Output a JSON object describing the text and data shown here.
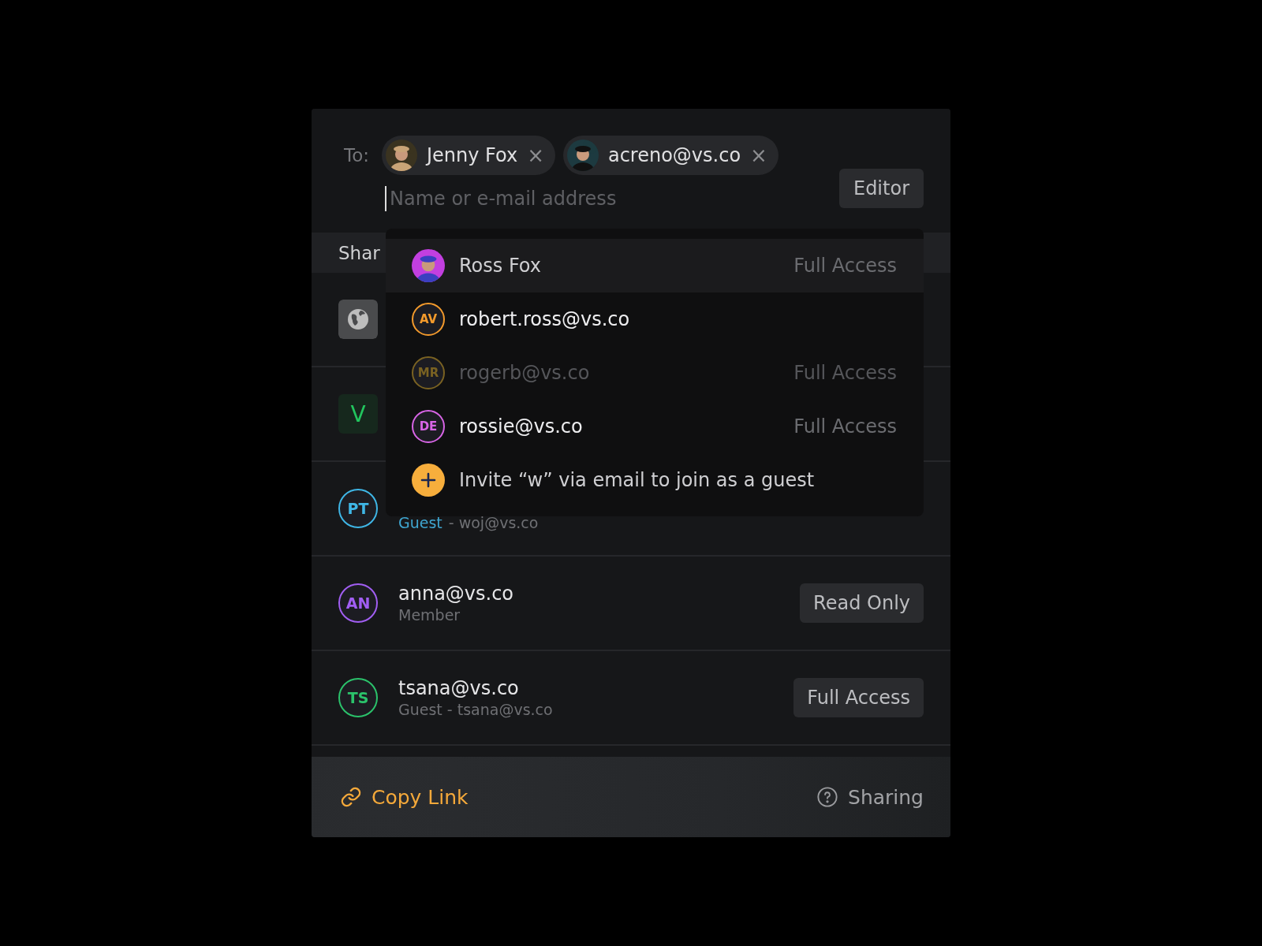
{
  "recipients": {
    "label": "To:",
    "chips": [
      {
        "name": "Jenny Fox",
        "remove": "×"
      },
      {
        "name": "acreno@vs.co",
        "remove": "×"
      }
    ],
    "input": {
      "placeholder": "Name or e-mail address"
    },
    "role_button": "Editor"
  },
  "section_header": "Shar",
  "rows": [
    {
      "kind": "globe"
    },
    {
      "kind": "letter",
      "initials": "V",
      "color": "#22c55e"
    },
    {
      "kind": "person",
      "initials": "PT",
      "color": "#3fb6e6",
      "subtitle_link": "Guest",
      "subtitle": "- woj@vs.co"
    },
    {
      "kind": "person",
      "initials": "AN",
      "color": "#a15ef2",
      "name": "anna@vs.co",
      "subtitle": "Member",
      "access": "Read Only"
    },
    {
      "kind": "person",
      "initials": "TS",
      "color": "#2bc26b",
      "name": "tsana@vs.co",
      "subtitle": "Guest - tsana@vs.co",
      "access": "Full Access"
    }
  ],
  "suggestions": [
    {
      "name": "Ross Fox",
      "access": "Full Access",
      "selected": true,
      "disabled": false
    },
    {
      "kind": "initials",
      "initials": "AV",
      "color": "#f39a2c",
      "name": "robert.ross@vs.co",
      "selected": false,
      "disabled": false
    },
    {
      "kind": "initials",
      "initials": "MR",
      "color": "#7a6222",
      "name": "rogerb@vs.co",
      "access": "Full Access",
      "selected": false,
      "disabled": true
    },
    {
      "kind": "initials",
      "initials": "DE",
      "color": "#d865e6",
      "name": "rossie@vs.co",
      "access": "Full Access",
      "selected": false,
      "disabled": false
    },
    {
      "kind": "invite",
      "name": "Invite “w” via email to join as a guest",
      "selected": false,
      "disabled": false
    }
  ],
  "footer": {
    "copy_link": "Copy Link",
    "help": "Sharing"
  }
}
